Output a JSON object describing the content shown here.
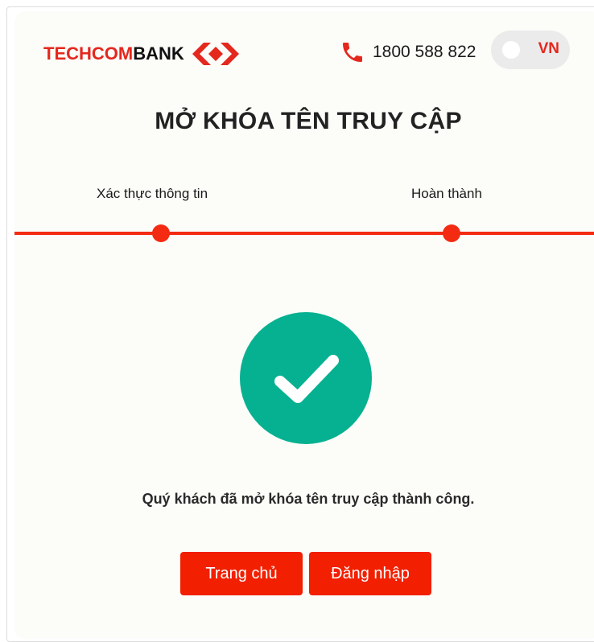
{
  "header": {
    "logo_text_left": "TECHCOM",
    "logo_text_right": "BANK",
    "hotline": "1800 588 822",
    "language": "VN"
  },
  "page": {
    "title": "MỞ KHÓA TÊN TRUY CẬP"
  },
  "steps": [
    {
      "label": "Xác thực thông tin"
    },
    {
      "label": "Hoàn thành"
    }
  ],
  "result": {
    "message": "Quý khách đã mở khóa tên truy cập thành công."
  },
  "actions": {
    "home_label": "Trang chủ",
    "login_label": "Đăng nhập"
  },
  "colors": {
    "brand_red": "#e4281e",
    "step_red": "#f32b12",
    "button_red": "#f21f00",
    "success_green": "#06b191"
  },
  "icons": {
    "phone": "phone-icon",
    "success": "checkmark-circle-icon",
    "logo": "techcombank-logo-icon"
  }
}
